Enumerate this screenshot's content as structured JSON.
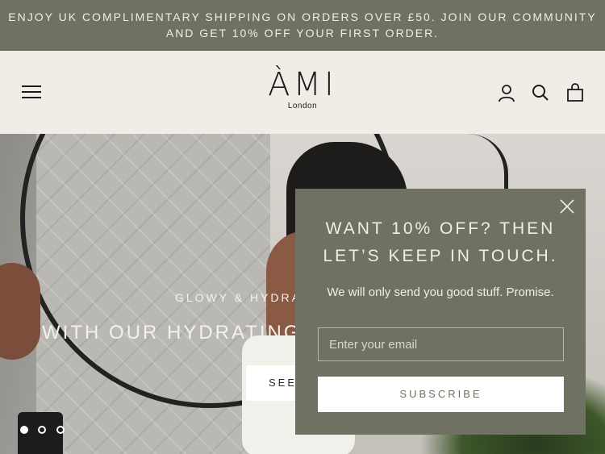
{
  "announcement": {
    "text": "ENJOY UK COMPLIMENTARY SHIPPING ON ORDERS OVER £50. JOIN OUR COMMUNITY AND GET 10% OFF YOUR FIRST ORDER."
  },
  "header": {
    "logo_main": "ÀMI",
    "logo_sub": "London",
    "icons": [
      "menu-icon",
      "account-icon",
      "search-icon",
      "cart-icon"
    ]
  },
  "hero": {
    "eyebrow": "GLOWY & HYDRA",
    "title": "WITH OUR HYDRATING",
    "button_label": "SEE",
    "slides": 3,
    "active_slide": 1
  },
  "popup": {
    "title_line1": "WANT 10% OFF? THEN",
    "title_line2": "LET’S KEEP IN TOUCH.",
    "subtitle": "We will only send you good stuff. Promise.",
    "email_placeholder": "Enter your email",
    "subscribe_label": "SUBSCRIBE"
  },
  "colors": {
    "brand_olive": "#6f7163",
    "header_bg": "#f2ece6",
    "text_dark": "#1b1b1b"
  }
}
